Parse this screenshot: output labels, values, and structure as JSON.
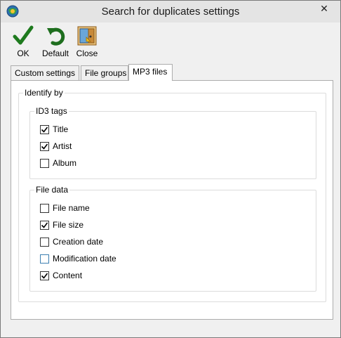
{
  "window": {
    "title": "Search for duplicates settings",
    "close_glyph": "✕"
  },
  "toolbar": {
    "ok_label": "OK",
    "default_label": "Default",
    "close_label": "Close"
  },
  "tabs": [
    "Custom settings",
    "File groups",
    "MP3 files"
  ],
  "active_tab": "MP3 files",
  "identify": {
    "label": "Identify by",
    "id3": {
      "label": "ID3 tags",
      "items": [
        {
          "label": "Title",
          "checked": true
        },
        {
          "label": "Artist",
          "checked": true
        },
        {
          "label": "Album",
          "checked": false
        }
      ]
    },
    "file_data": {
      "label": "File data",
      "items": [
        {
          "label": "File name",
          "checked": false
        },
        {
          "label": "File size",
          "checked": true
        },
        {
          "label": "Creation date",
          "checked": false
        },
        {
          "label": "Modification date",
          "checked": false
        },
        {
          "label": "Content",
          "checked": true
        }
      ]
    }
  },
  "icons": {
    "app": "app-globe-icon",
    "ok": "green-check-icon",
    "default": "undo-arrow-icon",
    "close": "exit-door-icon"
  },
  "colors": {
    "check_green": "#1e7a1e",
    "undo_green": "#1e6e1e",
    "hover_blue": "#3c7fb1"
  }
}
